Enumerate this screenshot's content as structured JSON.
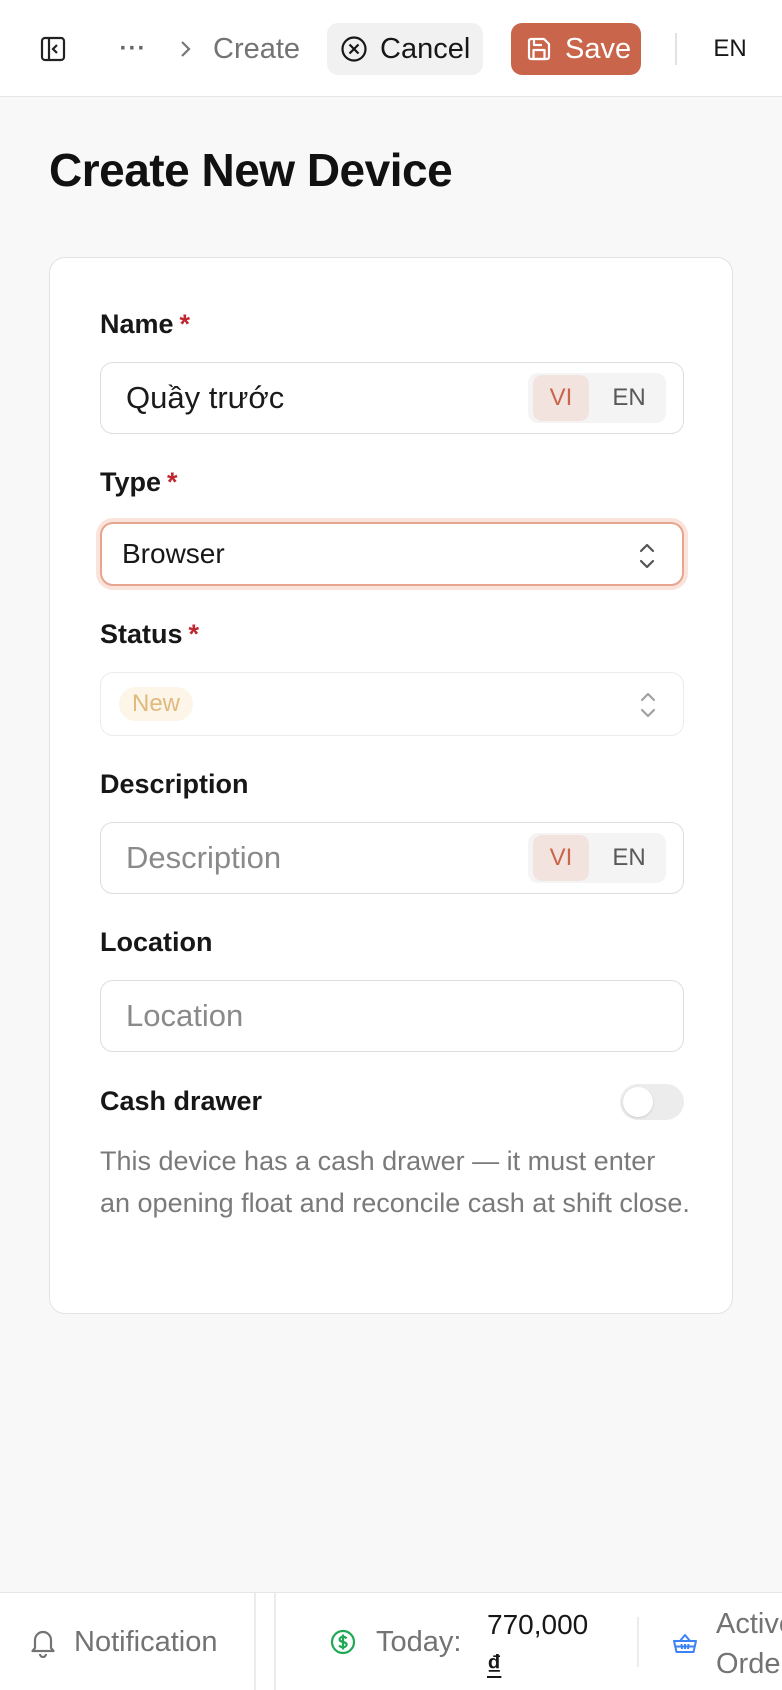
{
  "header": {
    "more_label": "···",
    "breadcrumb_current": "Create",
    "cancel_label": "Cancel",
    "save_label": "Save",
    "language": "EN"
  },
  "page": {
    "title": "Create New Device"
  },
  "form": {
    "name": {
      "label": "Name",
      "required_mark": "*",
      "value": "Quầy trước",
      "lang_vi": "VI",
      "lang_en": "EN"
    },
    "type": {
      "label": "Type",
      "required_mark": "*",
      "value": "Browser"
    },
    "status": {
      "label": "Status",
      "required_mark": "*",
      "value": "New"
    },
    "description": {
      "label": "Description",
      "placeholder": "Description",
      "lang_vi": "VI",
      "lang_en": "EN"
    },
    "location": {
      "label": "Location",
      "placeholder": "Location"
    },
    "cash_drawer": {
      "label": "Cash drawer",
      "enabled": false,
      "help": "This device has a cash drawer — it must enter an opening float and reconcile cash at shift close."
    }
  },
  "footer": {
    "notification_label": "Notification",
    "today_label": "Today:",
    "today_amount": "770,000",
    "today_currency": "₫",
    "active_orders_label": "Active Orders"
  },
  "colors": {
    "accent": "#c9654a",
    "required": "#c0262d",
    "status_new": "#e0b97d",
    "today_icon": "#1fa855",
    "orders_icon": "#3b82f6"
  }
}
